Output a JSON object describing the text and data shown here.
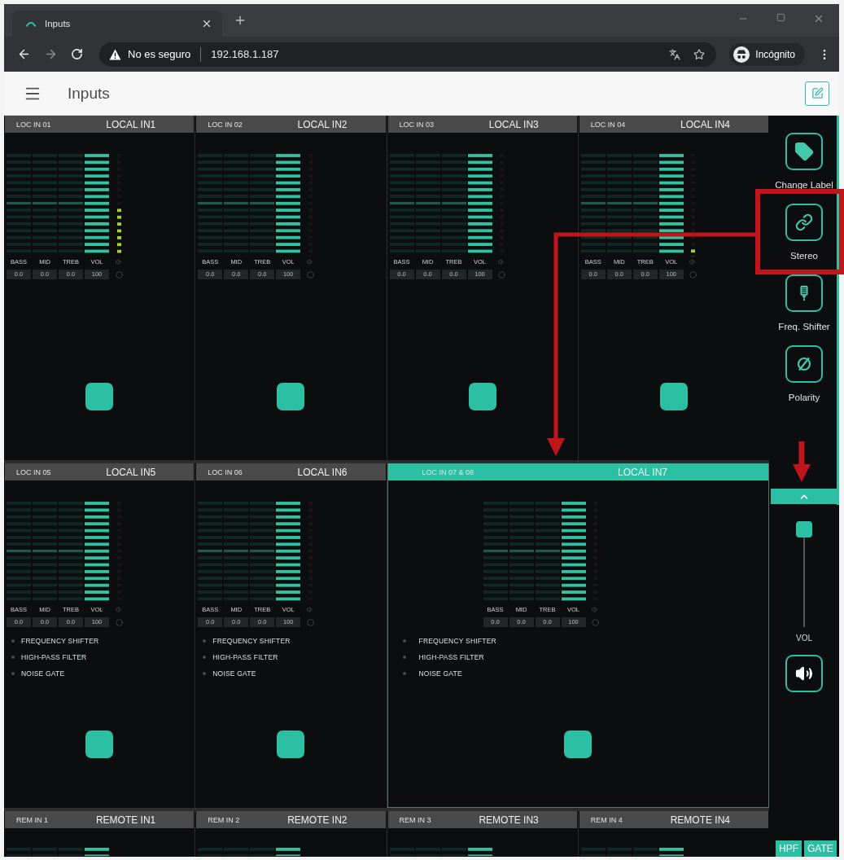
{
  "browser": {
    "tab_title": "Inputs",
    "security_label": "No es seguro",
    "url": "192.168.1.187",
    "profile_label": "Incógnito"
  },
  "app_bar": {
    "title": "Inputs"
  },
  "channels": [
    {
      "code": "LOC IN 01",
      "name": "LOCAL IN1",
      "kind": "mono",
      "selected": false,
      "signal": {
        "level": 0.47
      },
      "bands": [
        {
          "label": "BASS",
          "value": "0.0",
          "kind": "eq",
          "level": 0.5
        },
        {
          "label": "MID",
          "value": "0.0",
          "kind": "eq",
          "level": 0.5
        },
        {
          "label": "TREB",
          "value": "0.0",
          "kind": "eq",
          "level": 0.5
        },
        {
          "label": "VOL",
          "value": "100",
          "kind": "fill",
          "level": 1
        }
      ]
    },
    {
      "code": "LOC IN 02",
      "name": "LOCAL IN2",
      "kind": "mono",
      "selected": false,
      "bands": [
        {
          "label": "BASS",
          "value": "0.0",
          "kind": "eq",
          "level": 0.5
        },
        {
          "label": "MID",
          "value": "0.0",
          "kind": "eq",
          "level": 0.5
        },
        {
          "label": "TREB",
          "value": "0.0",
          "kind": "eq",
          "level": 0.5
        },
        {
          "label": "VOL",
          "value": "100",
          "kind": "fill",
          "level": 1
        }
      ]
    },
    {
      "code": "LOC IN 03",
      "name": "LOCAL IN3",
      "kind": "mono",
      "selected": false,
      "bands": [
        {
          "label": "BASS",
          "value": "0.0",
          "kind": "eq",
          "level": 0.5
        },
        {
          "label": "MID",
          "value": "0.0",
          "kind": "eq",
          "level": 0.5
        },
        {
          "label": "TREB",
          "value": "0.0",
          "kind": "eq",
          "level": 0.5
        },
        {
          "label": "VOL",
          "value": "100",
          "kind": "fill",
          "level": 1
        }
      ]
    },
    {
      "code": "LOC IN 04",
      "name": "LOCAL IN4",
      "kind": "mono",
      "selected": false,
      "signal": {
        "level": 0.07
      },
      "bands": [
        {
          "label": "BASS",
          "value": "0.0",
          "kind": "eq",
          "level": 0.5
        },
        {
          "label": "MID",
          "value": "0.0",
          "kind": "eq",
          "level": 0.5
        },
        {
          "label": "TREB",
          "value": "0.0",
          "kind": "eq",
          "level": 0.5
        },
        {
          "label": "VOL",
          "value": "100",
          "kind": "fill",
          "level": 1
        }
      ]
    },
    {
      "code": "LOC IN 05",
      "name": "LOCAL IN5",
      "kind": "mono",
      "selected": false,
      "bands": [
        {
          "label": "BASS",
          "value": "0.0",
          "kind": "eq",
          "level": 0.5
        },
        {
          "label": "MID",
          "value": "0.0",
          "kind": "eq",
          "level": 0.5
        },
        {
          "label": "TREB",
          "value": "0.0",
          "kind": "eq",
          "level": 0.5
        },
        {
          "label": "VOL",
          "value": "100",
          "kind": "fill",
          "level": 1
        }
      ],
      "features": [
        {
          "label": "FREQUENCY SHIFTER",
          "on": false
        },
        {
          "label": "HIGH-PASS FILTER",
          "on": false
        },
        {
          "label": "NOISE GATE",
          "on": false
        }
      ]
    },
    {
      "code": "LOC IN 06",
      "name": "LOCAL IN6",
      "kind": "mono",
      "selected": false,
      "bands": [
        {
          "label": "BASS",
          "value": "0.0",
          "kind": "eq",
          "level": 0.5
        },
        {
          "label": "MID",
          "value": "0.0",
          "kind": "eq",
          "level": 0.5
        },
        {
          "label": "TREB",
          "value": "0.0",
          "kind": "eq",
          "level": 0.5
        },
        {
          "label": "VOL",
          "value": "100",
          "kind": "fill",
          "level": 1
        }
      ],
      "features": [
        {
          "label": "FREQUENCY SHIFTER",
          "on": false
        },
        {
          "label": "HIGH-PASS FILTER",
          "on": false
        },
        {
          "label": "NOISE GATE",
          "on": false
        }
      ]
    },
    {
      "code": "LOC IN 07 & 08",
      "name": "LOCAL IN7",
      "kind": "stereo",
      "selected": true,
      "bands": [
        {
          "label": "BASS",
          "value": "0.0",
          "kind": "eq",
          "level": 0.5
        },
        {
          "label": "MID",
          "value": "0.0",
          "kind": "eq",
          "level": 0.5
        },
        {
          "label": "TREB",
          "value": "0.0",
          "kind": "eq",
          "level": 0.5
        },
        {
          "label": "VOL",
          "value": "100",
          "kind": "fill",
          "level": 1
        }
      ],
      "features": [
        {
          "label": "FREQUENCY SHIFTER",
          "on": false
        },
        {
          "label": "HIGH-PASS FILTER",
          "on": false
        },
        {
          "label": "NOISE GATE",
          "on": false
        }
      ]
    },
    {
      "code": "REM IN 1",
      "name": "REMOTE IN1",
      "kind": "mono",
      "selected": false
    },
    {
      "code": "REM IN 2",
      "name": "REMOTE IN2",
      "kind": "mono",
      "selected": false
    },
    {
      "code": "REM IN 3",
      "name": "REMOTE IN3",
      "kind": "mono",
      "selected": false
    },
    {
      "code": "REM IN 4",
      "name": "REMOTE IN4",
      "kind": "mono",
      "selected": false
    }
  ],
  "sidebar": {
    "items": [
      {
        "label": "Change Label",
        "highlighted": false
      },
      {
        "label": "Stereo",
        "highlighted": true
      },
      {
        "label": "Freq. Shifter",
        "highlighted": false
      },
      {
        "label": "Polarity",
        "highlighted": false
      }
    ],
    "volume": {
      "label": "VOL",
      "level": 1
    },
    "badges": [
      {
        "label": "HPF",
        "on": true
      },
      {
        "label": "GATE",
        "on": true
      }
    ]
  },
  "annotations": [
    {
      "kind": "elbow-arrow"
    },
    {
      "kind": "down-arrow"
    }
  ]
}
